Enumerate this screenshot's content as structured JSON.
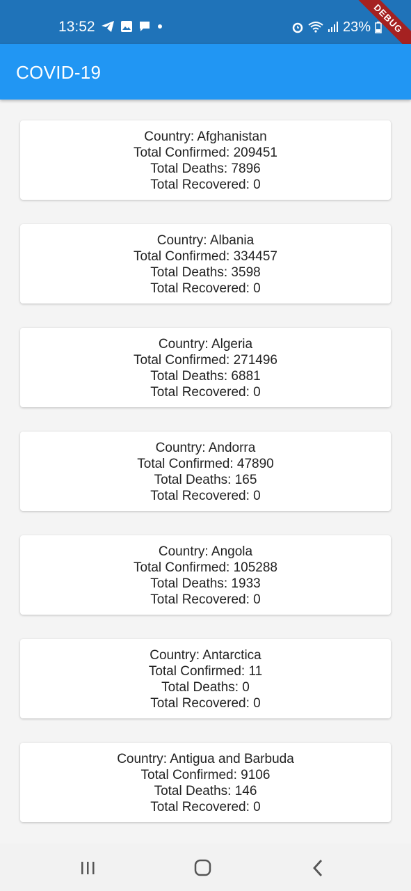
{
  "status_bar": {
    "time": "13:52",
    "battery": "23%",
    "left_icons": [
      "telegram-icon",
      "image-icon",
      "message-icon",
      "dot-icon"
    ],
    "right_icons": [
      "alarm-icon",
      "wifi-icon",
      "signal-icon",
      "battery-icon"
    ]
  },
  "debug_banner": "DEBUG",
  "app_bar": {
    "title": "COVID-19"
  },
  "countries": [
    {
      "country": "Country: Afghanistan",
      "confirmed": "Total Confirmed: 209451",
      "deaths": "Total Deaths: 7896",
      "recovered": "Total Recovered: 0"
    },
    {
      "country": "Country: Albania",
      "confirmed": "Total Confirmed: 334457",
      "deaths": "Total Deaths: 3598",
      "recovered": "Total Recovered: 0"
    },
    {
      "country": "Country: Algeria",
      "confirmed": "Total Confirmed: 271496",
      "deaths": "Total Deaths: 6881",
      "recovered": "Total Recovered: 0"
    },
    {
      "country": "Country: Andorra",
      "confirmed": "Total Confirmed: 47890",
      "deaths": "Total Deaths: 165",
      "recovered": "Total Recovered: 0"
    },
    {
      "country": "Country: Angola",
      "confirmed": "Total Confirmed: 105288",
      "deaths": "Total Deaths: 1933",
      "recovered": "Total Recovered: 0"
    },
    {
      "country": "Country: Antarctica",
      "confirmed": "Total Confirmed: 11",
      "deaths": "Total Deaths: 0",
      "recovered": "Total Recovered: 0"
    },
    {
      "country": "Country: Antigua and Barbuda",
      "confirmed": "Total Confirmed: 9106",
      "deaths": "Total Deaths: 146",
      "recovered": "Total Recovered: 0"
    }
  ],
  "nav_bar": {
    "buttons": [
      "recents-icon",
      "home-icon",
      "back-icon"
    ]
  },
  "colors": {
    "status_bar": "#1f73b9",
    "app_bar": "#2196f3",
    "background": "#f4f4f4",
    "card": "#ffffff",
    "debug": "#a52121"
  }
}
